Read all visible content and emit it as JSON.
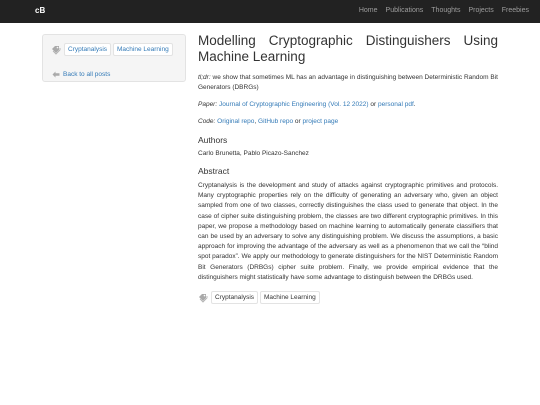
{
  "navbar": {
    "brand": "cB",
    "links": [
      "Home",
      "Publications",
      "Thoughts",
      "Projects",
      "Freebies"
    ]
  },
  "sidebar": {
    "tags": [
      "Cryptanalysis",
      "Machine Learning"
    ],
    "back_link": "Back to all posts"
  },
  "post": {
    "title_line1": "Modelling Cryptographic Distinguishers Using",
    "title_line2": "Machine Learning",
    "tldr_label": "tl;dr:",
    "tldr_text": "we show that sometimes ML has an advantage in distinguishing between Deterministic Random Bit Generators (DBRGs)",
    "paper_label": "Paper:",
    "paper_link": "Journal of Cryptographic Engineering (Vol. 12 2022)",
    "paper_or": "or",
    "paper_pdf": "personal pdf",
    "code_label": "Code:",
    "code_links": [
      "Original repo",
      "GitHub repo",
      "project page"
    ],
    "code_or": "or",
    "authors_heading": "Authors",
    "authors": "Carlo Brunetta, Pablo Picazo-Sanchez",
    "abstract_heading": "Abstract",
    "abstract": "Cryptanalysis is the development and study of attacks against cryptographic primitives and protocols. Many cryptographic properties rely on the difficulty of generating an adversary who, given an object sampled from one of two classes, correctly distinguishes the class used to generate that object. In the case of cipher suite distinguishing problem, the classes are two different cryptographic primitives. In this paper, we propose a methodology based on machine learning to automatically generate classifiers that can be used by an adversary to solve any distinguishing problem. We discuss the assumptions, a basic approach for improving the advantage of the adversary as well as a phenomenon that we call the “blind spot paradox”. We apply our methodology to generate distinguishers for the NIST Deterministic Random Bit Generators (DRBGs) cipher suite problem. Finally, we provide empirical evidence that the distinguishers might statistically have some advantage to distinguish between the DRBGs used.",
    "bottom_tags": [
      "Cryptanalysis",
      "Machine Learning"
    ]
  },
  "colors": {
    "navbar_bg": "#222222",
    "link": "#337ab7",
    "text": "#333333",
    "sidebar_bg": "#f5f5f5"
  },
  "icons": {
    "tag": "tags-icon",
    "back": "arrow-left-icon"
  }
}
